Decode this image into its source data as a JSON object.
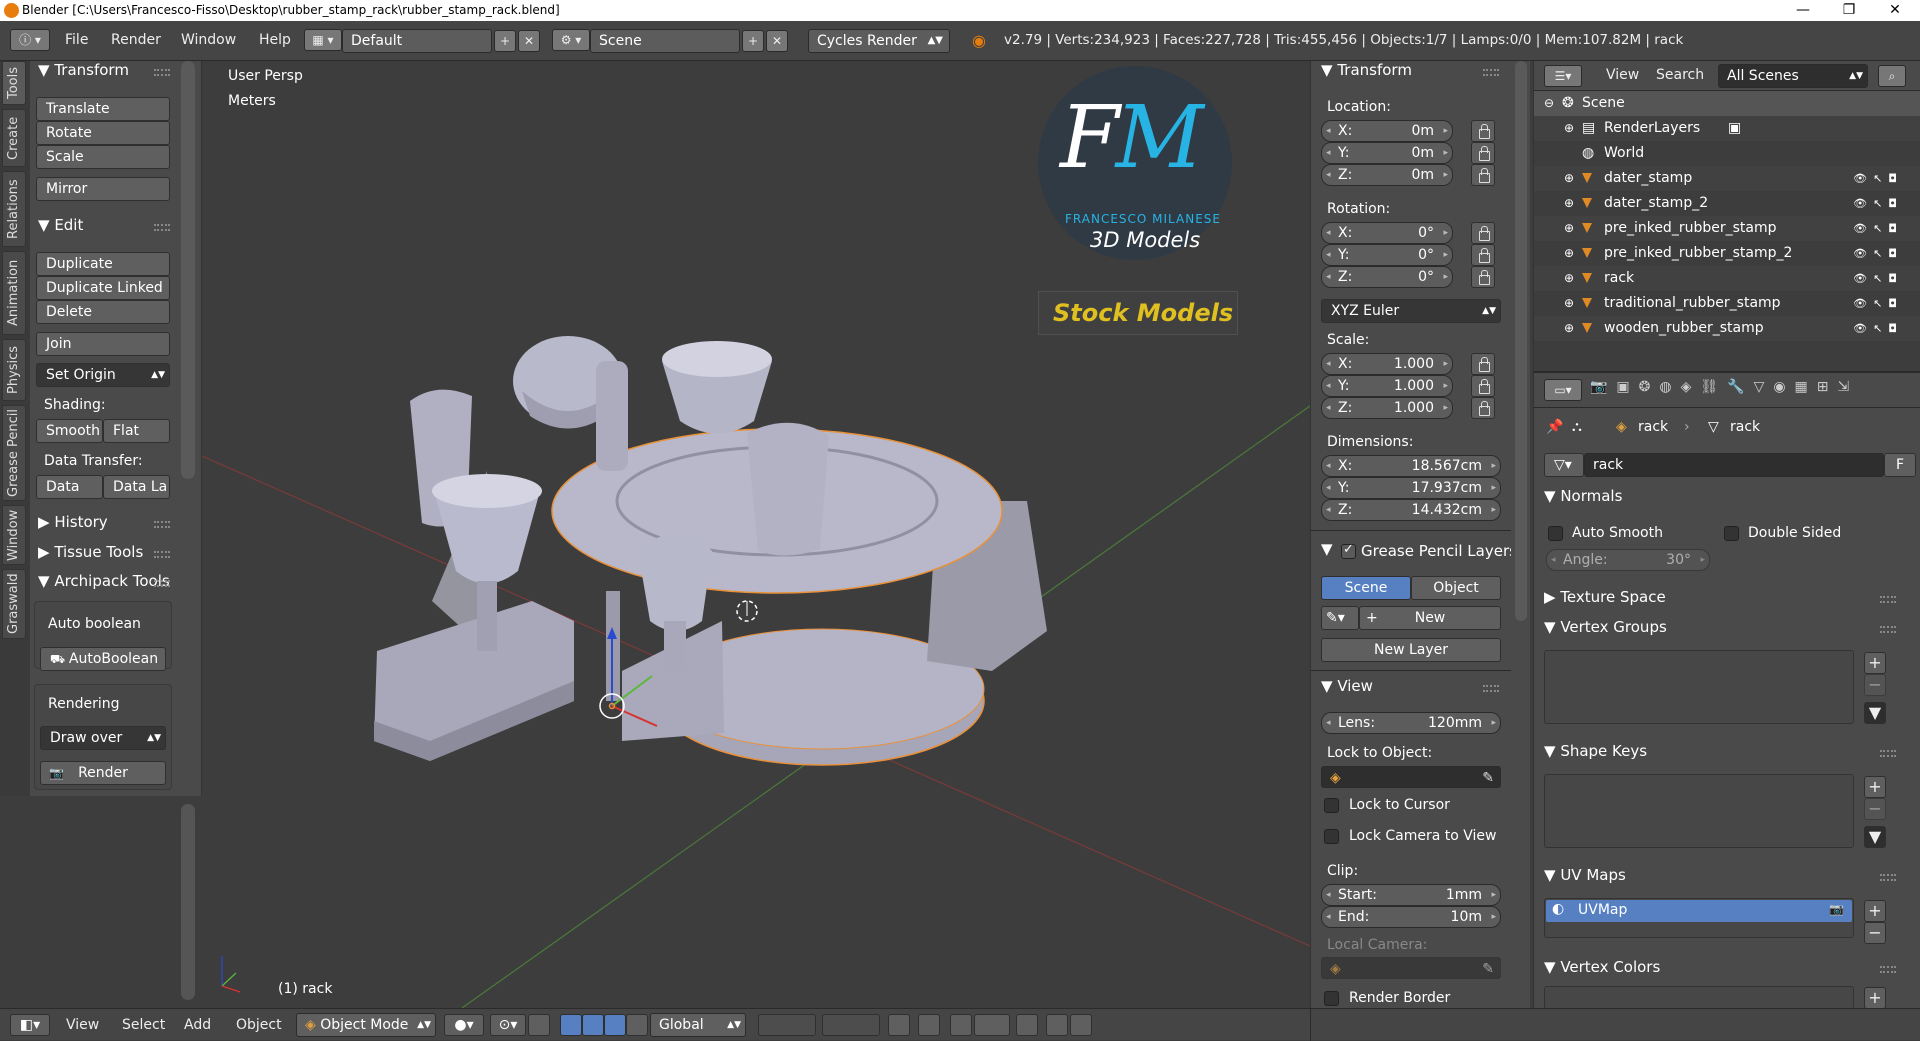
{
  "window": {
    "title": "Blender [C:\\Users\\Francesco-Fisso\\Desktop\\rubber_stamp_rack\\rubber_stamp_rack.blend]",
    "minimize": "—",
    "maximize": "❐",
    "close": "✕"
  },
  "infobar": {
    "menus": [
      "File",
      "Render",
      "Window",
      "Help"
    ],
    "layout": "Default",
    "scene": "Scene",
    "engine": "Cycles Render",
    "stats": "v2.79 | Verts:234,923 | Faces:227,728 | Tris:455,456 | Objects:1/7 | Lamps:0/0 | Mem:107.82M | rack"
  },
  "tool_tabs": [
    "Tools",
    "Create",
    "Relations",
    "Animation",
    "Physics",
    "Grease Pencil",
    "Window",
    "Graswald"
  ],
  "toolshelf": {
    "transform": {
      "title": "Transform",
      "buttons": [
        "Translate",
        "Rotate",
        "Scale",
        "Mirror"
      ]
    },
    "edit": {
      "title": "Edit",
      "buttons": [
        "Duplicate",
        "Duplicate Linked",
        "Delete",
        "Join"
      ],
      "set_origin": "Set Origin"
    },
    "shading": {
      "label": "Shading:",
      "smooth": "Smooth",
      "flat": "Flat"
    },
    "data_transfer": {
      "label": "Data Transfer:",
      "data": "Data",
      "data_la": "Data La"
    },
    "history": "History",
    "tissue": "Tissue Tools",
    "archipack": "Archipack Tools",
    "auto_boolean_label": "Auto boolean",
    "auto_boolean_btn": "AutoBoolean",
    "rendering_label": "Rendering",
    "draw_over": "Draw over",
    "render_btn": "Render"
  },
  "viewport": {
    "view_name": "User Persp",
    "units": "Meters",
    "object_label": "(1) rack",
    "logo": {
      "big": "FM",
      "name": "FRANCESCO MILANESE",
      "sub": "3D Models",
      "stock": "Stock Models"
    },
    "colors": {
      "background": "#3d3d3d",
      "model": "#b0b0c0",
      "selection": "#e8903a",
      "x_axis": "#c83232",
      "y_axis": "#5a9a3a",
      "z_axis": "#2a4ad0"
    }
  },
  "npanel": {
    "transform_title": "Transform",
    "location_label": "Location:",
    "location": [
      {
        "k": "X:",
        "v": "0m"
      },
      {
        "k": "Y:",
        "v": "0m"
      },
      {
        "k": "Z:",
        "v": "0m"
      }
    ],
    "rotation_label": "Rotation:",
    "rotation": [
      {
        "k": "X:",
        "v": "0°"
      },
      {
        "k": "Y:",
        "v": "0°"
      },
      {
        "k": "Z:",
        "v": "0°"
      }
    ],
    "rotation_mode": "XYZ Euler",
    "scale_label": "Scale:",
    "scale": [
      {
        "k": "X:",
        "v": "1.000"
      },
      {
        "k": "Y:",
        "v": "1.000"
      },
      {
        "k": "Z:",
        "v": "1.000"
      }
    ],
    "dimensions_label": "Dimensions:",
    "dimensions": [
      {
        "k": "X:",
        "v": "18.567cm"
      },
      {
        "k": "Y:",
        "v": "17.937cm"
      },
      {
        "k": "Z:",
        "v": "14.432cm"
      }
    ],
    "grease_title": "Grease Pencil Layers",
    "scene_btn": "Scene",
    "object_btn": "Object",
    "new_btn": "New",
    "new_layer_btn": "New Layer",
    "view_title": "View",
    "lens_k": "Lens:",
    "lens_v": "120mm",
    "lock_to_object": "Lock to Object:",
    "lock_to_cursor": "Lock to Cursor",
    "lock_camera": "Lock Camera to View",
    "clip_label": "Clip:",
    "clip_start_k": "Start:",
    "clip_start_v": "1mm",
    "clip_end_k": "End:",
    "clip_end_v": "10m",
    "local_camera": "Local Camera:",
    "render_border": "Render Border"
  },
  "outliner": {
    "view": "View",
    "search": "Search",
    "filter": "All Scenes",
    "scene": "Scene",
    "render_layers": "RenderLayers",
    "world": "World",
    "objects": [
      "dater_stamp",
      "dater_stamp_2",
      "pre_inked_rubber_stamp",
      "pre_inked_rubber_stamp_2",
      "rack",
      "traditional_rubber_stamp",
      "wooden_rubber_stamp"
    ]
  },
  "properties": {
    "breadcrumb_obj": "rack",
    "breadcrumb_data": "rack",
    "name": "rack",
    "fake_user": "F",
    "normals_title": "Normals",
    "auto_smooth": "Auto Smooth",
    "double_sided": "Double Sided",
    "angle_k": "Angle:",
    "angle_v": "30°",
    "texture_space": "Texture Space",
    "vertex_groups": "Vertex Groups",
    "shape_keys": "Shape Keys",
    "uv_maps": "UV Maps",
    "uvmap": "UVMap",
    "vertex_colors": "Vertex Colors"
  },
  "footer": {
    "view": "View",
    "select": "Select",
    "add": "Add",
    "object": "Object",
    "mode": "Object Mode",
    "orientation": "Global"
  }
}
